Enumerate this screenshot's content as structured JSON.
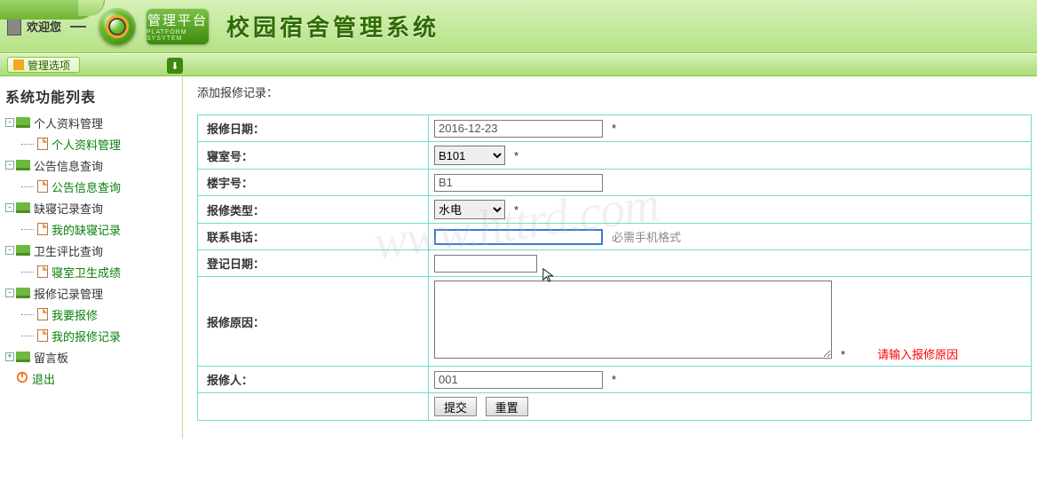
{
  "header": {
    "greeting": "欢迎您",
    "badge_title": "管理平台",
    "badge_sub": "PLATFORM SYSYTEM",
    "system_title": "校园宿舍管理系统"
  },
  "secbar": {
    "menu_label": "管理选项",
    "download_glyph": "⬇"
  },
  "sidebar": {
    "heading": "系统功能列表",
    "groups": [
      {
        "label": "个人资料管理",
        "children": [
          {
            "label": "个人资料管理",
            "link": true
          }
        ]
      },
      {
        "label": "公告信息查询",
        "children": [
          {
            "label": "公告信息查询",
            "link": true
          }
        ]
      },
      {
        "label": "缺寝记录查询",
        "children": [
          {
            "label": "我的缺寝记录",
            "link": true
          }
        ]
      },
      {
        "label": "卫生评比查询",
        "children": [
          {
            "label": "寝室卫生成绩",
            "link": true
          }
        ]
      },
      {
        "label": "报修记录管理",
        "children": [
          {
            "label": "我要报修",
            "link": true
          },
          {
            "label": "我的报修记录",
            "link": true
          }
        ]
      },
      {
        "label": "留言板",
        "children": []
      }
    ],
    "logout": "退出"
  },
  "form": {
    "title": "添加报修记录：",
    "fields": {
      "repair_date": {
        "label": "报修日期：",
        "value": "2016-12-23",
        "required": true
      },
      "dorm_no": {
        "label": "寝室号：",
        "value": "B101",
        "required": true
      },
      "building_no": {
        "label": "楼宇号：",
        "value": "B1"
      },
      "repair_type": {
        "label": "报修类型：",
        "value": "水电",
        "required": true
      },
      "phone": {
        "label": "联系电话：",
        "value": "",
        "hint": "必需手机格式"
      },
      "reg_date": {
        "label": "登记日期：",
        "value": ""
      },
      "reason": {
        "label": "报修原因：",
        "value": "",
        "required": true,
        "error": "请输入报修原因"
      },
      "reporter": {
        "label": "报修人：",
        "value": "001",
        "required": true
      }
    },
    "star": "*",
    "buttons": {
      "submit": "提交",
      "reset": "重置"
    }
  },
  "watermark": "www.httrd.com"
}
